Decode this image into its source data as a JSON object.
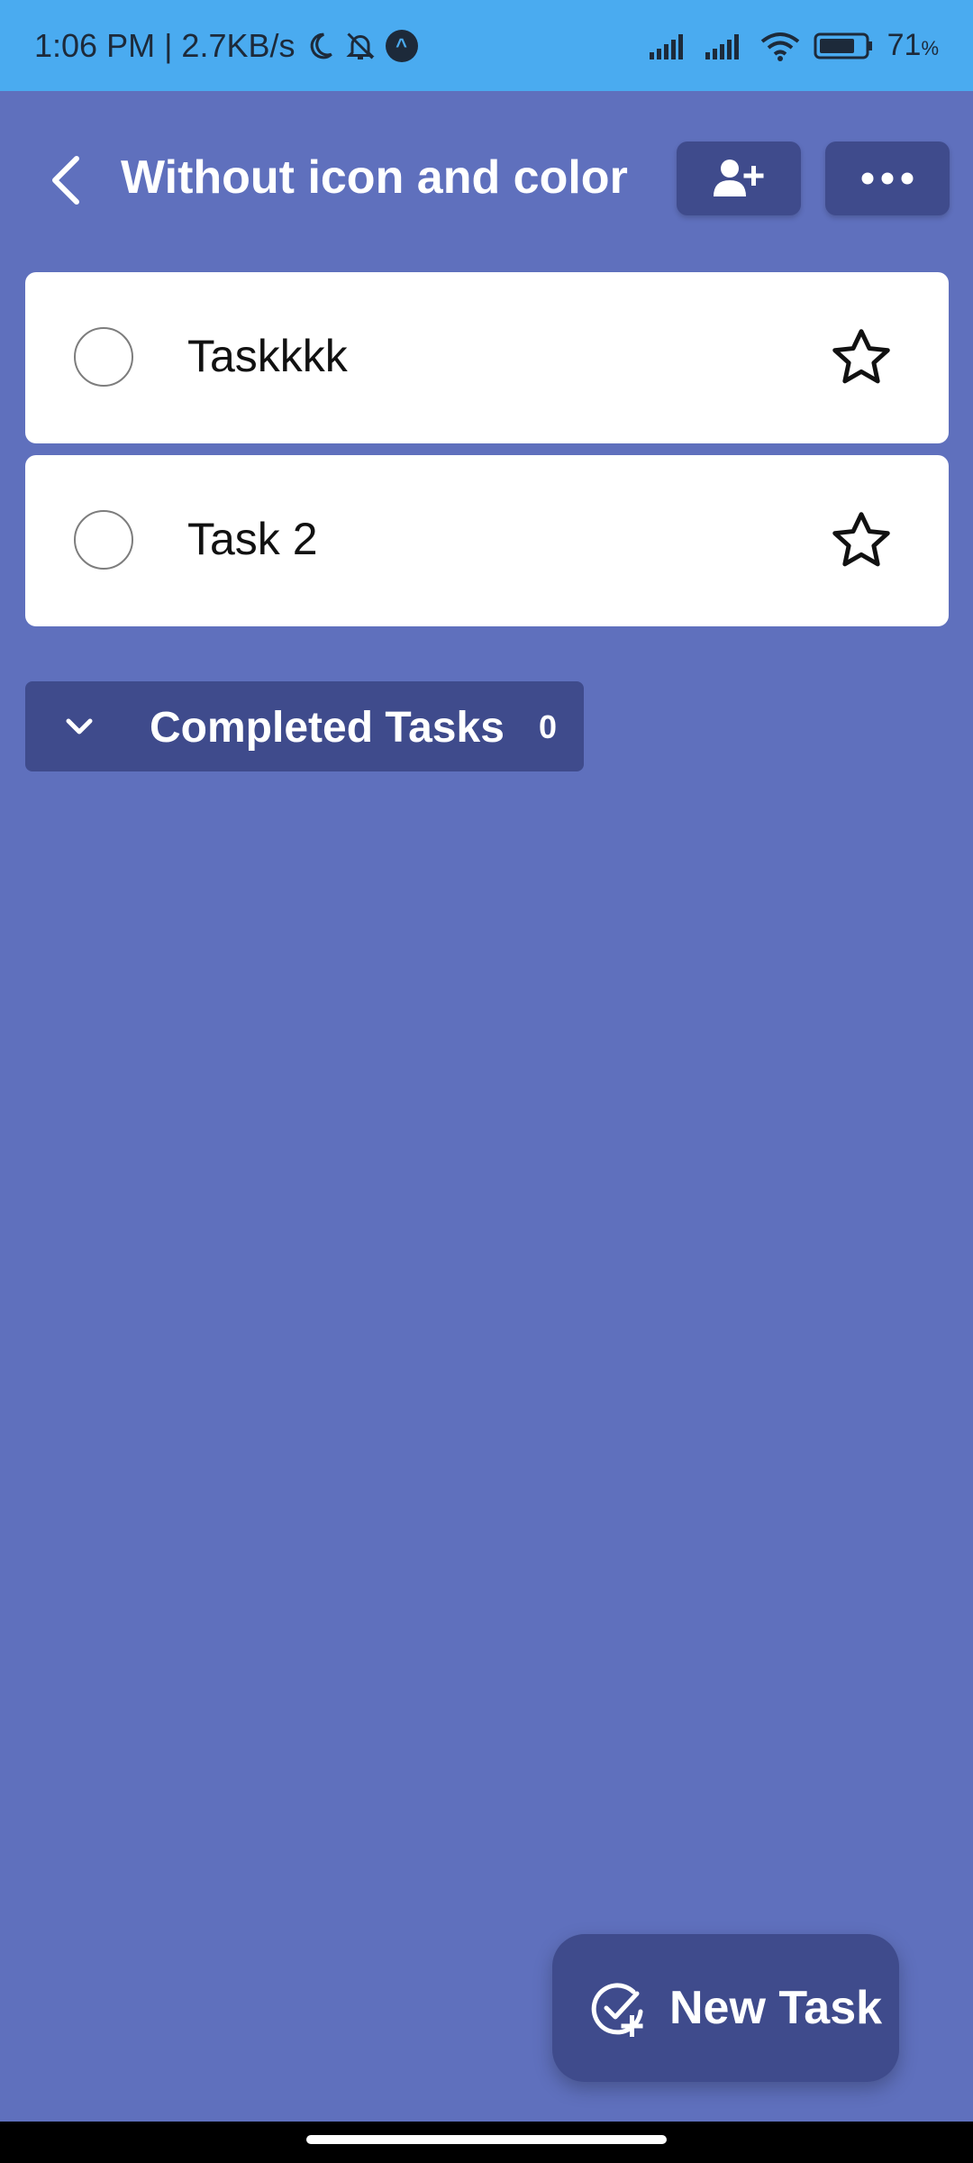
{
  "status_bar": {
    "time_speed": "1:06 PM | 2.7KB/s",
    "battery_level": "71",
    "battery_unit": "%",
    "icons": [
      "moon-icon",
      "bell-off-icon",
      "app-badge-icon",
      "signal-icon",
      "signal-icon",
      "wifi-icon",
      "battery-icon"
    ]
  },
  "header": {
    "title": "Without icon and color",
    "back_icon": "chevron-left-icon",
    "share_icon": "add-user-icon",
    "more_icon": "more-horizontal-icon"
  },
  "tasks": [
    {
      "title": "Taskkkk",
      "completed": false,
      "starred": false
    },
    {
      "title": "Task 2",
      "completed": false,
      "starred": false
    }
  ],
  "completed_section": {
    "label": "Completed Tasks",
    "count": "0"
  },
  "fab": {
    "label": "New Task",
    "icon": "check-circle-plus-icon"
  },
  "colors": {
    "background": "#5f70bd",
    "status_bar": "#4aabf0",
    "accent_dark": "#3f4b8c",
    "card": "#ffffff"
  }
}
